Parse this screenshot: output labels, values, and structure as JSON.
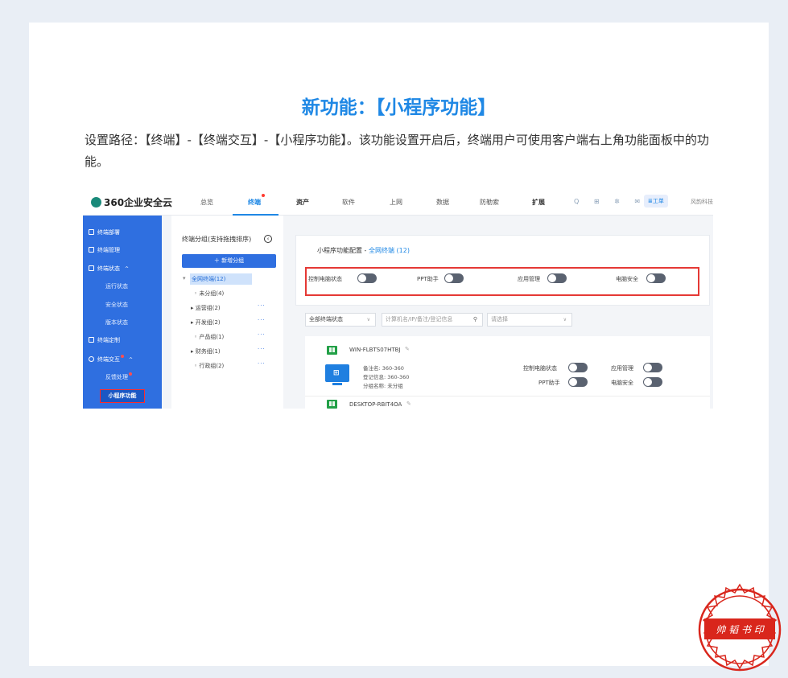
{
  "article": {
    "headline": "新功能：【小程序功能】",
    "description": "设置路径：【终端】-【终端交互】-【小程序功能】。该功能设置开启后，终端用户可使用客户端右上角功能面板中的功能。"
  },
  "topbar": {
    "logo": "360企业安全云",
    "nav": [
      "总览",
      "终端",
      "资产",
      "软件",
      "上网",
      "数据",
      "防勒索",
      "扩展"
    ],
    "active_nav": "终端",
    "tool_icons": "Q ⊞ ✲ ✉ ⚙",
    "workbench": "≣工单",
    "company": "风韵科技"
  },
  "sidebar": {
    "items": [
      "终端部署",
      "终端管理",
      "终端状态",
      "运行状态",
      "安全状态",
      "版本状态",
      "终端定制",
      "终端交互",
      "反馈处理",
      "小程序功能"
    ],
    "active": "小程序功能"
  },
  "groups": {
    "title": "终端分组(支持拖拽排序)",
    "add_button": "＋ 新增分组",
    "all_terminals": "全网终端(12)",
    "tree": [
      "未分组(4)",
      "运营组(2)",
      "开发组(2)",
      "产品组(1)",
      "财务组(1)",
      "行政组(2)"
    ],
    "more": "···"
  },
  "config": {
    "title_prefix": "小程序功能配置 - ",
    "title_highlight": "全网终端 (12)",
    "switches": [
      "控制电脑状态",
      "PPT助手",
      "应用管理",
      "电脑安全"
    ]
  },
  "filters": {
    "status": "全部终端状态",
    "search_placeholder": "计算机名/IP/备注/登记信息",
    "select_placeholder": "请选择"
  },
  "terminals": [
    {
      "name": "WIN-FLBTS07HTBJ",
      "remark": "备注名: 360-360",
      "reg": "登记信息: 360-360",
      "group": "分组名称: 未分组",
      "switches": [
        "控制电脑状态",
        "应用管理",
        "PPT助手",
        "电脑安全"
      ]
    },
    {
      "name": "DESKTOP-RBIT4OA"
    }
  ],
  "stamp": {
    "text": "帅 韬 书 印",
    "color": "#d9261c"
  },
  "colors": {
    "accent": "#1f88e5",
    "sidebar": "#2f6fe0",
    "highlight": "#e53935"
  }
}
